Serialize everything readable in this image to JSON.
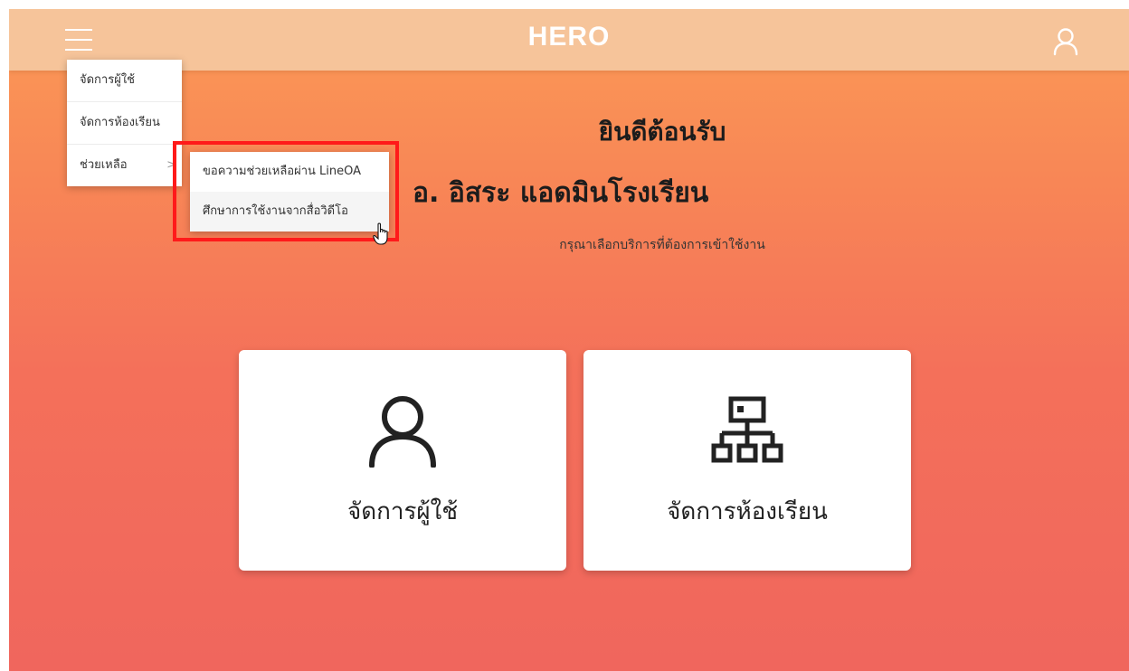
{
  "header": {
    "brand": "HERO",
    "menu_icon": "hamburger-menu-icon",
    "user_icon": "user-icon"
  },
  "nav_menu": {
    "items": [
      {
        "label": "จัดการผู้ใช้"
      },
      {
        "label": "จัดการห้องเรียน"
      },
      {
        "label": "ช่วยเหลือ",
        "has_submenu": true
      }
    ],
    "submenu": {
      "items": [
        {
          "label": "ขอความช่วยเหลือผ่าน LineOA"
        },
        {
          "label": "ศึกษาการใช้งานจากสื่อวิดีโอ",
          "hovered": true
        }
      ]
    }
  },
  "main": {
    "welcome": "ยินดีต้อนรับ",
    "admin_name": "อ. อิสระ แอดมินโรงเรียน",
    "subtitle": "กรุณาเลือกบริการที่ต้องการเข้าใช้งาน"
  },
  "cards": [
    {
      "label": "จัดการผู้ใช้",
      "icon": "user-icon"
    },
    {
      "label": "จัดการห้องเรียน",
      "icon": "sitemap-icon"
    }
  ],
  "colors": {
    "topbar": "#f6c49a",
    "gradient_top": "#fb9a56",
    "gradient_bottom": "#f0665d",
    "highlight": "#ff1a1a"
  }
}
